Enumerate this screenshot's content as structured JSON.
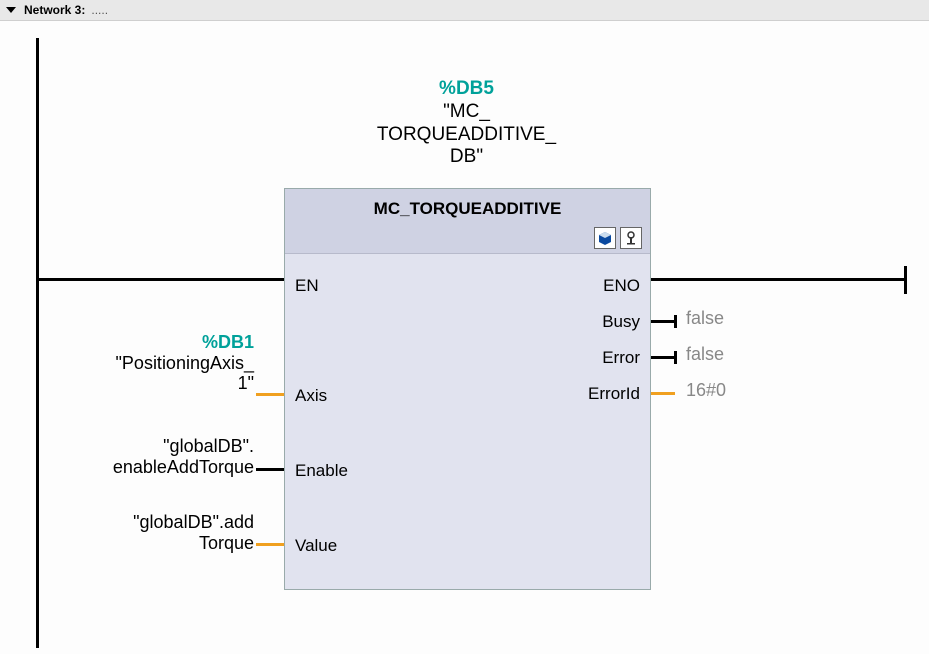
{
  "network": {
    "title": "Network 3:",
    "subtitle": "....."
  },
  "instance_db": {
    "addr": "%DB5",
    "name_l1": "\"MC_",
    "name_l2": "TORQUEADDITIVE_",
    "name_l3": "DB\""
  },
  "block": {
    "name": "MC_TORQUEADDITIVE",
    "inputs": {
      "en": "EN",
      "axis": "Axis",
      "enable": "Enable",
      "value": "Value"
    },
    "outputs": {
      "eno": "ENO",
      "busy": "Busy",
      "error": "Error",
      "errorid": "ErrorId"
    }
  },
  "operands": {
    "axis": {
      "addr": "%DB1",
      "name_l1": "\"PositioningAxis_",
      "name_l2": "1\""
    },
    "enable": {
      "name_l1": "\"globalDB\".",
      "name_l2": "enableAddTorque"
    },
    "value": {
      "name_l1": "\"globalDB\".add",
      "name_l2": "Torque"
    }
  },
  "outputs": {
    "busy": "false",
    "error": "false",
    "errorid": "16#0"
  }
}
